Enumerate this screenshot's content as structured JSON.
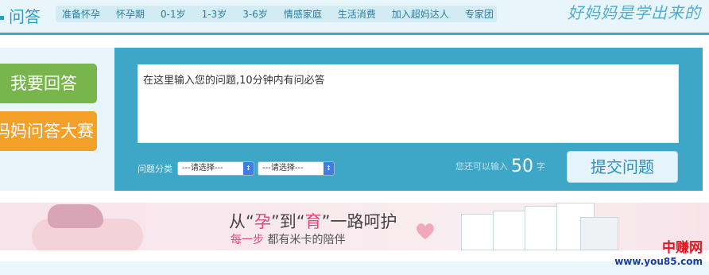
{
  "header": {
    "brand": "问答",
    "nav": [
      "准备怀孕",
      "怀孕期",
      "0-1岁",
      "1-3岁",
      "3-6岁",
      "情感家庭",
      "生活消费",
      "加入超妈达人",
      "专家团"
    ],
    "slogan": "好妈妈是学出来的"
  },
  "sidebar": {
    "answer_button": "我要回答",
    "contest_button": "妈妈问答大赛"
  },
  "ask": {
    "placeholder": "在这里输入您的问题,10分钟内有问必答",
    "category_label": "问题分类",
    "select1": "---请选择---",
    "select2": "---请选择---",
    "remain_prefix": "您还可以输入",
    "remain_count": "50",
    "remain_suffix": "字",
    "submit": "提交问题"
  },
  "banner": {
    "t1": "从“",
    "t2": "孕",
    "t3": "”到“",
    "t4": "育",
    "t5": "”一路呵护",
    "s1": "每一步",
    "s2": " 都有米卡的陪伴"
  },
  "watermark": {
    "line1": "中赚网",
    "line2": "www.you85.com"
  },
  "colors": {
    "accent": "#3ea6c7",
    "green": "#78b54d",
    "orange": "#f2a027",
    "pink": "#e4457b"
  }
}
